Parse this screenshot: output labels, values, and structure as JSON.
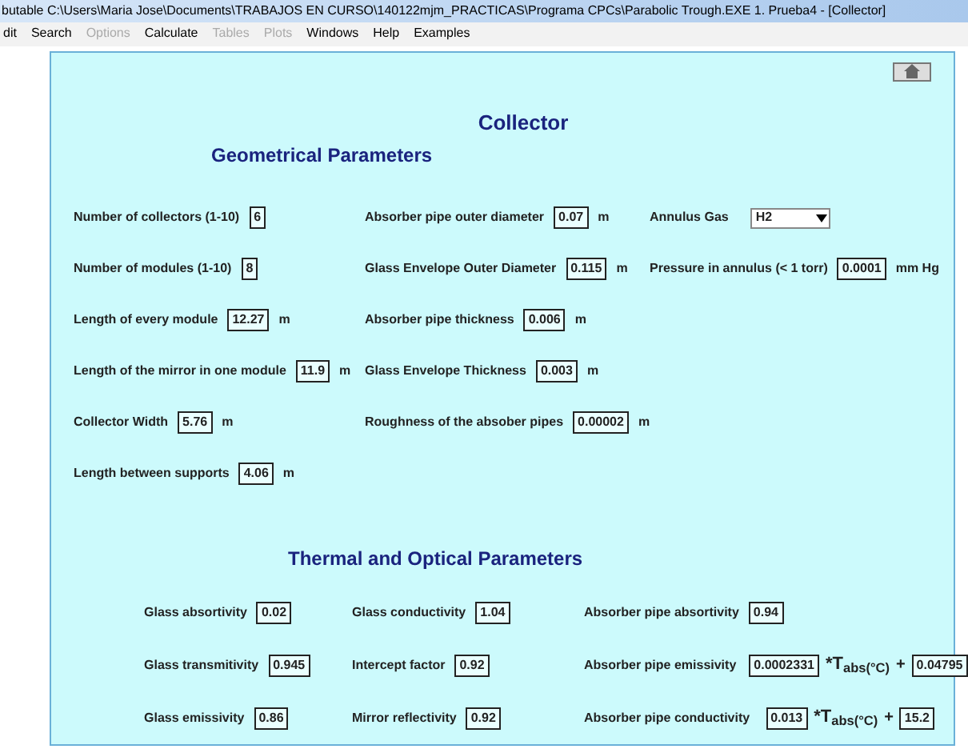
{
  "window": {
    "title": "butable  C:\\Users\\Maria Jose\\Documents\\TRABAJOS EN CURSO\\140122mjm_PRACTICAS\\Programa CPCs\\Parabolic Trough.EXE   1. Prueba4 - [Collector]"
  },
  "menu": [
    {
      "label": "dit",
      "disabled": false
    },
    {
      "label": "Search",
      "disabled": false
    },
    {
      "label": "Options",
      "disabled": true
    },
    {
      "label": "Calculate",
      "disabled": false
    },
    {
      "label": "Tables",
      "disabled": true
    },
    {
      "label": "Plots",
      "disabled": true
    },
    {
      "label": "Windows",
      "disabled": false
    },
    {
      "label": "Help",
      "disabled": false
    },
    {
      "label": "Examples",
      "disabled": false
    }
  ],
  "panel": {
    "title": "Collector",
    "geometrical": {
      "heading": "Geometrical Parameters",
      "rows": [
        [
          {
            "kind": "field",
            "label": "Number of collectors (1-10)",
            "value": "6"
          },
          {
            "kind": "field",
            "label": "Absorber pipe outer diameter",
            "value": "0.07",
            "unit": "m"
          },
          {
            "kind": "dropdown",
            "label": "Annulus Gas",
            "value": "H2"
          }
        ],
        [
          {
            "kind": "field",
            "label": "Number of modules (1-10)",
            "value": "8"
          },
          {
            "kind": "field",
            "label": "Glass Envelope Outer Diameter",
            "value": "0.115",
            "unit": "m"
          },
          {
            "kind": "field",
            "label": "Pressure in annulus (< 1 torr)",
            "value": "0.0001",
            "unit": "mm Hg"
          }
        ],
        [
          {
            "kind": "field",
            "label": "Length of every module",
            "value": "12.27",
            "unit": "m"
          },
          {
            "kind": "field",
            "label": "Absorber pipe thickness",
            "value": "0.006",
            "unit": "m"
          }
        ],
        [
          {
            "kind": "field",
            "label": "Length of the mirror in one module",
            "value": "11.9",
            "unit": "m"
          },
          {
            "kind": "field",
            "label": "Glass Envelope Thickness",
            "value": "0.003",
            "unit": "m"
          }
        ],
        [
          {
            "kind": "field",
            "label": "Collector Width",
            "value": "5.76",
            "unit": "m"
          },
          {
            "kind": "field",
            "label": "Roughness of the absober pipes",
            "value": "0.00002",
            "unit": "m"
          }
        ],
        [
          {
            "kind": "field",
            "label": "Length between supports",
            "value": "4.06",
            "unit": "m"
          }
        ]
      ]
    },
    "thermal": {
      "heading": "Thermal and Optical Parameters",
      "rows": [
        [
          {
            "kind": "field",
            "label": "Glass absortivity",
            "value": "0.02"
          },
          {
            "kind": "field",
            "label": "Glass conductivity",
            "value": "1.04"
          },
          {
            "kind": "field",
            "label": "Absorber pipe absortivity",
            "value": "0.94"
          }
        ],
        [
          {
            "kind": "field",
            "label": "Glass transmitivity",
            "value": "0.945"
          },
          {
            "kind": "field",
            "label": "Intercept factor",
            "value": "0.92"
          },
          {
            "kind": "formula",
            "label": "Absorber pipe emissivity",
            "value": "0.0002331",
            "term": "*T$_{abs(°C)}$",
            "plus": "+",
            "constant": "0.04795"
          }
        ],
        [
          {
            "kind": "field",
            "label": "Glass emissivity",
            "value": "0.86"
          },
          {
            "kind": "field",
            "label": "Mirror reflectivity",
            "value": "0.92"
          },
          {
            "kind": "formula",
            "label": "Absorber pipe conductivity",
            "value": "0.013",
            "term": "*T$_{abs(°C)}$",
            "plus": "+",
            "constant": "15.2"
          }
        ]
      ]
    }
  }
}
